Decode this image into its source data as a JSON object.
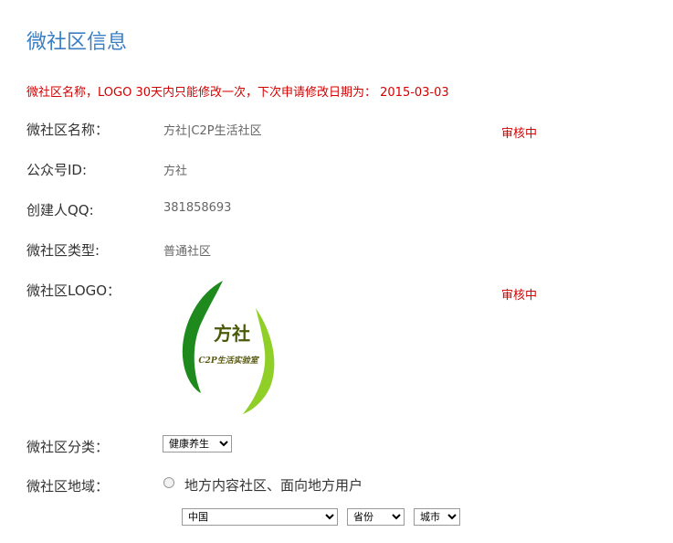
{
  "page_title": "微社区信息",
  "notice": "微社区名称，LOGO 30天内只能修改一次，下次申请修改日期为： 2015-03-03",
  "fields": {
    "name": {
      "label": "微社区名称：",
      "value": "方社|C2P生活社区",
      "status": "审核中"
    },
    "account_id": {
      "label": "公众号ID:",
      "value": "方社"
    },
    "creator_qq": {
      "label": "创建人QQ:",
      "value": "381858693"
    },
    "type": {
      "label": "微社区类型:",
      "value": "普通社区"
    },
    "logo": {
      "label": "微社区LOGO：",
      "status": "审核中",
      "logo_text_main": "方社",
      "logo_text_sub": "C2P生活实验室"
    },
    "category": {
      "label": "微社区分类：",
      "selected": "健康养生"
    },
    "region": {
      "label": "微社区地域：",
      "radio_label": "地方内容社区、面向地方用户",
      "country": "中国",
      "province": "省份",
      "city": "城市"
    }
  }
}
